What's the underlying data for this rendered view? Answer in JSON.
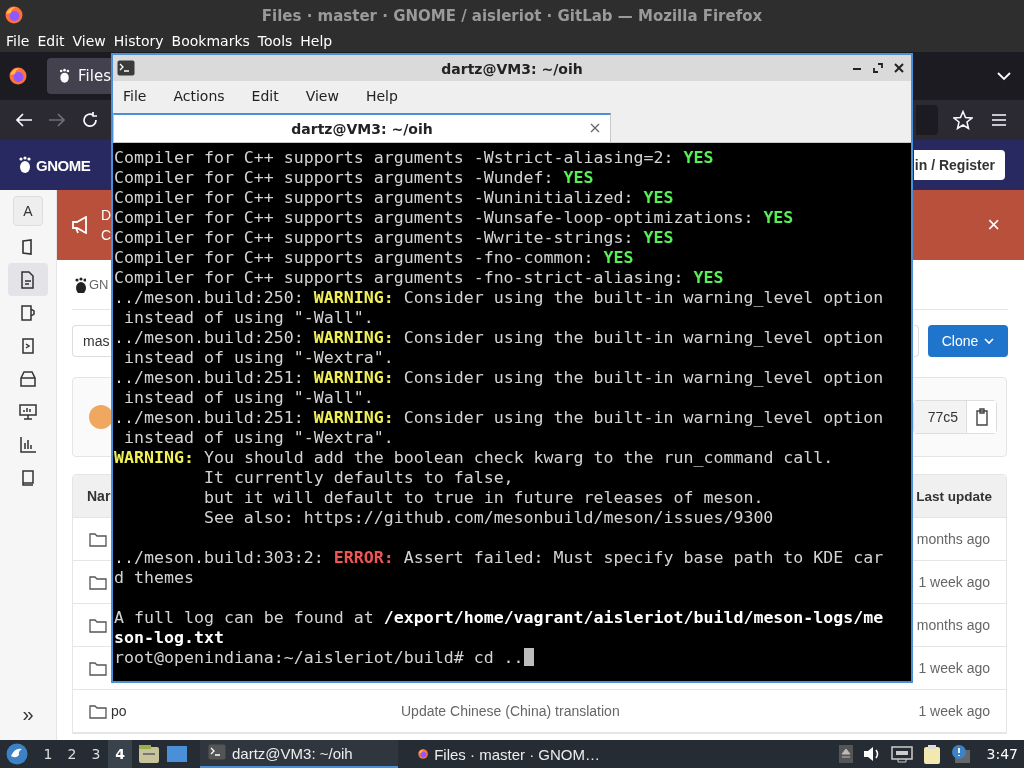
{
  "firefox": {
    "title": "Files · master · GNOME / aisleriot · GitLab — Mozilla Firefox",
    "menu": [
      "File",
      "Edit",
      "View",
      "History",
      "Bookmarks",
      "Tools",
      "Help"
    ],
    "tabs": [
      {
        "label": "Files",
        "selected": true
      }
    ],
    "navigation": {
      "forward_disabled": true
    },
    "gitlab": {
      "logo_text": "GNOME",
      "header_button": "in / Register",
      "sidebar": {
        "avatar": "A",
        "items": [
          {
            "kind": "project",
            "selected": false
          },
          {
            "kind": "repository",
            "selected": true
          },
          {
            "kind": "issues",
            "selected": false
          },
          {
            "kind": "merge-requests",
            "selected": false
          },
          {
            "kind": "packages",
            "selected": false
          },
          {
            "kind": "monitor",
            "selected": false
          },
          {
            "kind": "analytics",
            "selected": false
          },
          {
            "kind": "wiki",
            "selected": false
          }
        ],
        "collapse": "»"
      },
      "banner": {
        "line_1": "D",
        "line_2": "C",
        "close": "×"
      },
      "breadcrumb": "GN",
      "branch_field": "mas",
      "clone_button": "Clone",
      "commit_sha": "77c5",
      "table": {
        "columns": [
          "Nar",
          "Last update"
        ],
        "rows": [
          {
            "kind": "folder",
            "updated": "months ago"
          },
          {
            "kind": "folder",
            "updated": "1 week ago"
          },
          {
            "kind": "folder",
            "updated": "months ago"
          },
          {
            "kind": "folder",
            "updated": "1 week ago"
          },
          {
            "kind": "folder",
            "name": "po",
            "message": "Update Chinese (China) translation",
            "updated": "1 week ago"
          }
        ]
      }
    }
  },
  "terminal": {
    "title": "dartz@VM3: ~/oih",
    "menu": [
      "File",
      "Actions",
      "Edit",
      "View",
      "Help"
    ],
    "tabs": [
      {
        "label": "dartz@VM3: ~/oih",
        "selected": true
      }
    ],
    "lines": [
      {
        "kind": "text",
        "segments": [
          {
            "kind": "plain",
            "text": "Compiler for C++ supports arguments -Wstrict-aliasing=2: "
          },
          {
            "kind": "ok",
            "text": "YES"
          }
        ]
      },
      {
        "kind": "text",
        "segments": [
          {
            "kind": "plain",
            "text": "Compiler for C++ supports arguments -Wundef: "
          },
          {
            "kind": "ok",
            "text": "YES"
          }
        ]
      },
      {
        "kind": "text",
        "segments": [
          {
            "kind": "plain",
            "text": "Compiler for C++ supports arguments -Wuninitialized: "
          },
          {
            "kind": "ok",
            "text": "YES"
          }
        ]
      },
      {
        "kind": "text",
        "segments": [
          {
            "kind": "plain",
            "text": "Compiler for C++ supports arguments -Wunsafe-loop-optimizations: "
          },
          {
            "kind": "ok",
            "text": "YES"
          }
        ]
      },
      {
        "kind": "text",
        "segments": [
          {
            "kind": "plain",
            "text": "Compiler for C++ supports arguments -Wwrite-strings: "
          },
          {
            "kind": "ok",
            "text": "YES"
          }
        ]
      },
      {
        "kind": "text",
        "segments": [
          {
            "kind": "plain",
            "text": "Compiler for C++ supports arguments -fno-common: "
          },
          {
            "kind": "ok",
            "text": "YES"
          }
        ]
      },
      {
        "kind": "text",
        "segments": [
          {
            "kind": "plain",
            "text": "Compiler for C++ supports arguments -fno-strict-aliasing: "
          },
          {
            "kind": "ok",
            "text": "YES"
          }
        ]
      },
      {
        "kind": "text",
        "segments": [
          {
            "kind": "plain",
            "text": "../meson.build:250: "
          },
          {
            "kind": "warning",
            "text": "WARNING:"
          },
          {
            "kind": "plain",
            "text": " Consider using the built-in warning_level option"
          }
        ]
      },
      {
        "kind": "text",
        "segments": [
          {
            "kind": "plain",
            "text": " instead of using \"-Wall\"."
          }
        ]
      },
      {
        "kind": "text",
        "segments": [
          {
            "kind": "plain",
            "text": "../meson.build:250: "
          },
          {
            "kind": "warning",
            "text": "WARNING:"
          },
          {
            "kind": "plain",
            "text": " Consider using the built-in warning_level option"
          }
        ]
      },
      {
        "kind": "text",
        "segments": [
          {
            "kind": "plain",
            "text": " instead of using \"-Wextra\"."
          }
        ]
      },
      {
        "kind": "text",
        "segments": [
          {
            "kind": "plain",
            "text": "../meson.build:251: "
          },
          {
            "kind": "warning",
            "text": "WARNING:"
          },
          {
            "kind": "plain",
            "text": " Consider using the built-in warning_level option"
          }
        ]
      },
      {
        "kind": "text",
        "segments": [
          {
            "kind": "plain",
            "text": " instead of using \"-Wall\"."
          }
        ]
      },
      {
        "kind": "text",
        "segments": [
          {
            "kind": "plain",
            "text": "../meson.build:251: "
          },
          {
            "kind": "warning",
            "text": "WARNING:"
          },
          {
            "kind": "plain",
            "text": " Consider using the built-in warning_level option"
          }
        ]
      },
      {
        "kind": "text",
        "segments": [
          {
            "kind": "plain",
            "text": " instead of using \"-Wextra\"."
          }
        ]
      },
      {
        "kind": "text",
        "segments": [
          {
            "kind": "warning",
            "text": "WARNING:"
          },
          {
            "kind": "plain",
            "text": " You should add the boolean check kwarg to the run_command call."
          }
        ]
      },
      {
        "kind": "text",
        "segments": [
          {
            "kind": "plain",
            "text": "         It currently defaults to false,"
          }
        ]
      },
      {
        "kind": "text",
        "segments": [
          {
            "kind": "plain",
            "text": "         but it will default to true in future releases of meson."
          }
        ]
      },
      {
        "kind": "text",
        "segments": [
          {
            "kind": "plain",
            "text": "         See also: https://github.com/mesonbuild/meson/issues/9300"
          }
        ]
      },
      {
        "kind": "blank"
      },
      {
        "kind": "text",
        "segments": [
          {
            "kind": "plain",
            "text": "../meson.build:303:2: "
          },
          {
            "kind": "error",
            "text": "ERROR:"
          },
          {
            "kind": "plain",
            "text": " Assert failed: Must specify base path to KDE car"
          }
        ]
      },
      {
        "kind": "text",
        "segments": [
          {
            "kind": "plain",
            "text": "d themes"
          }
        ]
      },
      {
        "kind": "blank"
      },
      {
        "kind": "text",
        "segments": [
          {
            "kind": "plain",
            "text": "A full log can be found at "
          },
          {
            "kind": "bold",
            "text": "/export/home/vagrant/aisleriot/build/meson-logs/me"
          }
        ]
      },
      {
        "kind": "text",
        "segments": [
          {
            "kind": "bold",
            "text": "son-log.txt"
          }
        ]
      },
      {
        "kind": "text",
        "segments": [
          {
            "kind": "plain",
            "text": "root@openindiana:~/aisleriot/build# cd .."
          },
          {
            "kind": "cursor"
          }
        ]
      }
    ]
  },
  "taskbar": {
    "workspaces": [
      {
        "label": "1",
        "selected": false
      },
      {
        "label": "2",
        "selected": false
      },
      {
        "label": "3",
        "selected": false
      },
      {
        "label": "4",
        "selected": true
      }
    ],
    "tasks": [
      {
        "kind": "terminal",
        "label": "dartz@VM3: ~/oih",
        "selected": true
      },
      {
        "kind": "browser",
        "label": "Files · master · GNOM…",
        "selected": false
      }
    ],
    "clock": "3:47"
  }
}
